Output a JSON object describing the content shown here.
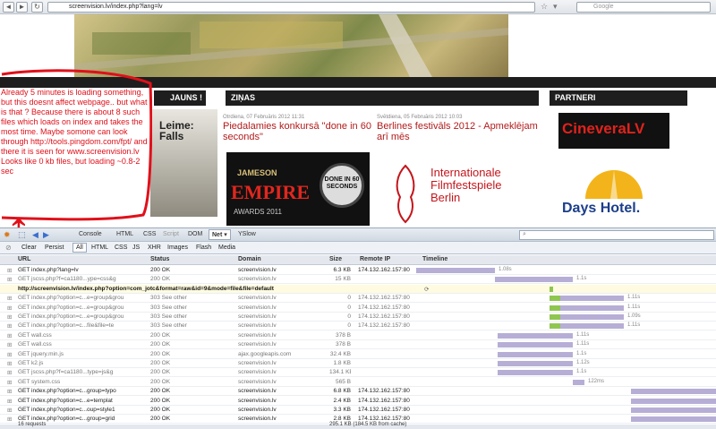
{
  "browser": {
    "url": "screenvision.lv/index.php?lang=lv",
    "search_placeholder": "Google",
    "back_glyph": "◄",
    "forward_glyph": "►",
    "reload_glyph": "↻",
    "star_glyph": "☆",
    "dropdown_glyph": "▾"
  },
  "site": {
    "jauns_label": "JAUNS !",
    "news_section": "ZIŅAS",
    "partners_section": "PARTNERI",
    "news": [
      {
        "date": "Otrdiena, 07 Februāris 2012 11:31",
        "title": "Piedalamies konkursā \"done in 60 seconds\""
      },
      {
        "date": "Svētdiena, 05 Februāris 2012 10:03",
        "title": "Berlines festivāls 2012 - Apmeklējam arī mēs"
      }
    ],
    "ads": {
      "empire_brand": "JAMESON",
      "empire_title": "EMPIRE",
      "empire_sub": "AWARDS 2011",
      "empire_badge": "DONE IN 60 SECONDS",
      "berlin_line1": "Internationale",
      "berlin_line2": "Filmfestspiele",
      "berlin_line3": "Berlin",
      "cinevera": "CineveraLV",
      "days_hotel": "Days Hotel.",
      "poster_title": "Leime: Falls"
    }
  },
  "annotation": {
    "text": "Already 5 minutes is loading something, but this doesnt affect webpage.. but what is that ? Because there is about 8 such files which loads on index and takes the most time. Maybe somone can look through http://tools.pingdom.com/fpt/ and there it is seen for www.screenvision.lv Looks like 0 kb files, but loading ~0.8-2 sec",
    "arrow_glyph": "↕"
  },
  "firebug": {
    "tabs": [
      "Console",
      "HTML",
      "CSS",
      "Script",
      "DOM",
      "Net ▾",
      "YSlow"
    ],
    "active_tab": "Net ▾",
    "filters": [
      "Clear",
      "Persist",
      "All",
      "HTML",
      "CSS",
      "JS",
      "XHR",
      "Images",
      "Flash",
      "Media"
    ],
    "columns": {
      "url": "URL",
      "status": "Status",
      "domain": "Domain",
      "size": "Size",
      "remote_ip": "Remote IP",
      "timeline": "Timeline"
    },
    "requests": [
      {
        "url": "GET index.php?lang=lv",
        "status": "200 OK",
        "domain": "screenvision.lv",
        "size": "6.3 KB",
        "ip": "174.132.162.157:80",
        "time": "1.08s"
      },
      {
        "url": "GET jscss.php?f=ca1180...ype=css&g",
        "status": "200 OK",
        "domain": "screenvision.lv",
        "size": "15 KB",
        "ip": "",
        "time": "1.1s"
      },
      {
        "url": "http://screenvision.lv/index.php?option=com_jotc&format=raw&id=9&mode=file&file=default",
        "status": "",
        "domain": "",
        "size": "",
        "ip": "",
        "time": ""
      },
      {
        "url": "GET index.php?option=c...e=group&grou",
        "status": "303 See other",
        "domain": "screenvision.lv",
        "size": "0",
        "ip": "174.132.162.157:80",
        "time": "1.11s"
      },
      {
        "url": "GET index.php?option=c...e=group&grou",
        "status": "303 See other",
        "domain": "screenvision.lv",
        "size": "0",
        "ip": "174.132.162.157:80",
        "time": "1.11s"
      },
      {
        "url": "GET index.php?option=c...e=group&grou",
        "status": "303 See other",
        "domain": "screenvision.lv",
        "size": "0",
        "ip": "174.132.162.157:80",
        "time": "1.09s"
      },
      {
        "url": "GET index.php?option=c...file&file=te",
        "status": "303 See other",
        "domain": "screenvision.lv",
        "size": "0",
        "ip": "174.132.162.157:80",
        "time": "1.11s"
      },
      {
        "url": "GET wall.css",
        "status": "200 OK",
        "domain": "screenvision.lv",
        "size": "378 B",
        "ip": "",
        "time": "1.11s"
      },
      {
        "url": "GET wall.css",
        "status": "200 OK",
        "domain": "screenvision.lv",
        "size": "378 B",
        "ip": "",
        "time": "1.11s"
      },
      {
        "url": "GET jquery.min.js",
        "status": "200 OK",
        "domain": "ajax.googleapis.com",
        "size": "32.4 KB",
        "ip": "",
        "time": "1.1s"
      },
      {
        "url": "GET k2.js",
        "status": "200 OK",
        "domain": "screenvision.lv",
        "size": "1.8 KB",
        "ip": "",
        "time": "1.12s"
      },
      {
        "url": "GET jscss.php?f=ca1180...type=js&g",
        "status": "200 OK",
        "domain": "screenvision.lv",
        "size": "134.1 KB",
        "ip": "",
        "time": "1.1s"
      },
      {
        "url": "GET system.css",
        "status": "200 OK",
        "domain": "screenvision.lv",
        "size": "565 B",
        "ip": "",
        "time": "122ms"
      },
      {
        "url": "GET index.php?option=c...group=typo",
        "status": "200 OK",
        "domain": "screenvision.lv",
        "size": "6.8 KB",
        "ip": "174.132.162.157:80",
        "time": ""
      },
      {
        "url": "GET index.php?option=c...e=templat",
        "status": "200 OK",
        "domain": "screenvision.lv",
        "size": "2.4 KB",
        "ip": "174.132.162.157:80",
        "time": ""
      },
      {
        "url": "GET index.php?option=c...oup=style1",
        "status": "200 OK",
        "domain": "screenvision.lv",
        "size": "3.3 KB",
        "ip": "174.132.162.157:80",
        "time": ""
      },
      {
        "url": "GET index.php?option=c...group=grid",
        "status": "200 OK",
        "domain": "screenvision.lv",
        "size": "2.8 KB",
        "ip": "174.132.162.157:80",
        "time": ""
      }
    ],
    "summary_left": "16 requests",
    "summary_right": "295.1 KB  (184.5 KB from cache)",
    "colors": {
      "bar": "#b7aed6",
      "bar_dark": "#8d80bf",
      "wait": "#8fc64f",
      "annot": "#e0101a"
    }
  }
}
